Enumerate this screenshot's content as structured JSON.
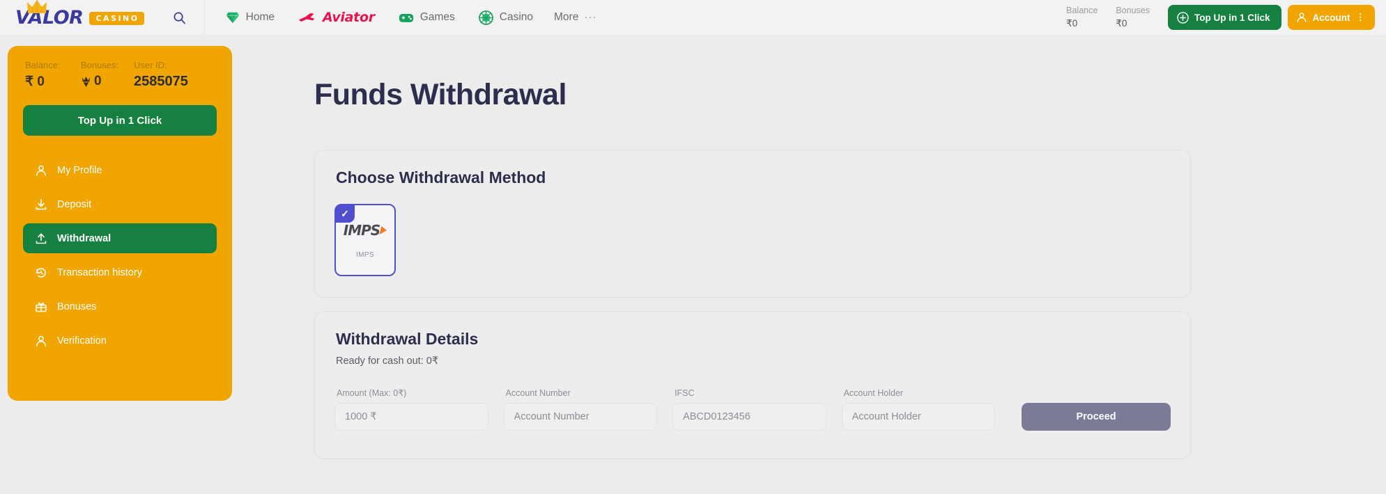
{
  "topbar": {
    "logo_text": "VALOR",
    "logo_badge": "CASINO",
    "search_icon": "search-icon",
    "nav": [
      {
        "label": "Home",
        "icon": "gem-icon"
      },
      {
        "label": "Aviator",
        "icon": "plane-icon"
      },
      {
        "label": "Games",
        "icon": "gamepad-icon"
      },
      {
        "label": "Casino",
        "icon": "roulette-icon"
      }
    ],
    "more_label": "More",
    "more_dots": "···",
    "balance_label": "Balance",
    "balance_value": "₹0",
    "bonuses_label": "Bonuses",
    "bonuses_value": "₹0",
    "topup_label": "Top Up in 1 Click",
    "account_label": "Account",
    "account_caret": "⋮"
  },
  "sidebar": {
    "balance_label": "Balance:",
    "balance_value": "₹ 0",
    "bonuses_label": "Bonuses:",
    "bonuses_value": "0",
    "userid_label": "User ID:",
    "userid_value": "2585075",
    "topup_label": "Top Up in 1 Click",
    "items": [
      {
        "label": "My Profile",
        "icon": "user-icon",
        "active": false
      },
      {
        "label": "Deposit",
        "icon": "download-icon",
        "active": false
      },
      {
        "label": "Withdrawal",
        "icon": "upload-icon",
        "active": true
      },
      {
        "label": "Transaction history",
        "icon": "history-icon",
        "active": false
      },
      {
        "label": "Bonuses",
        "icon": "gift-icon",
        "active": false
      },
      {
        "label": "Verification",
        "icon": "user-check-icon",
        "active": false
      }
    ]
  },
  "main": {
    "page_title": "Funds Withdrawal",
    "method_card": {
      "title": "Choose Withdrawal Method",
      "methods": [
        {
          "logo": "IMPS",
          "name": "IMPS",
          "selected": true,
          "check": "✓"
        }
      ]
    },
    "details_card": {
      "title": "Withdrawal Details",
      "subtitle": "Ready for cash out: 0₹",
      "fields": [
        {
          "label": "Amount (Max: 0₹)",
          "placeholder": "1000 ₹",
          "value": ""
        },
        {
          "label": "Account Number",
          "placeholder": "Account Number",
          "value": ""
        },
        {
          "label": "IFSC",
          "placeholder": "ABCD0123456",
          "value": ""
        },
        {
          "label": "Account Holder",
          "placeholder": "Account Holder",
          "value": ""
        }
      ],
      "proceed_label": "Proceed"
    }
  },
  "colors": {
    "brand_orange": "#f0a500",
    "brand_green": "#158040",
    "brand_indigo": "#3b3a9e",
    "accent_red": "#e8134e",
    "select_purple": "#4f4fcf",
    "page_bg": "#ececec"
  }
}
